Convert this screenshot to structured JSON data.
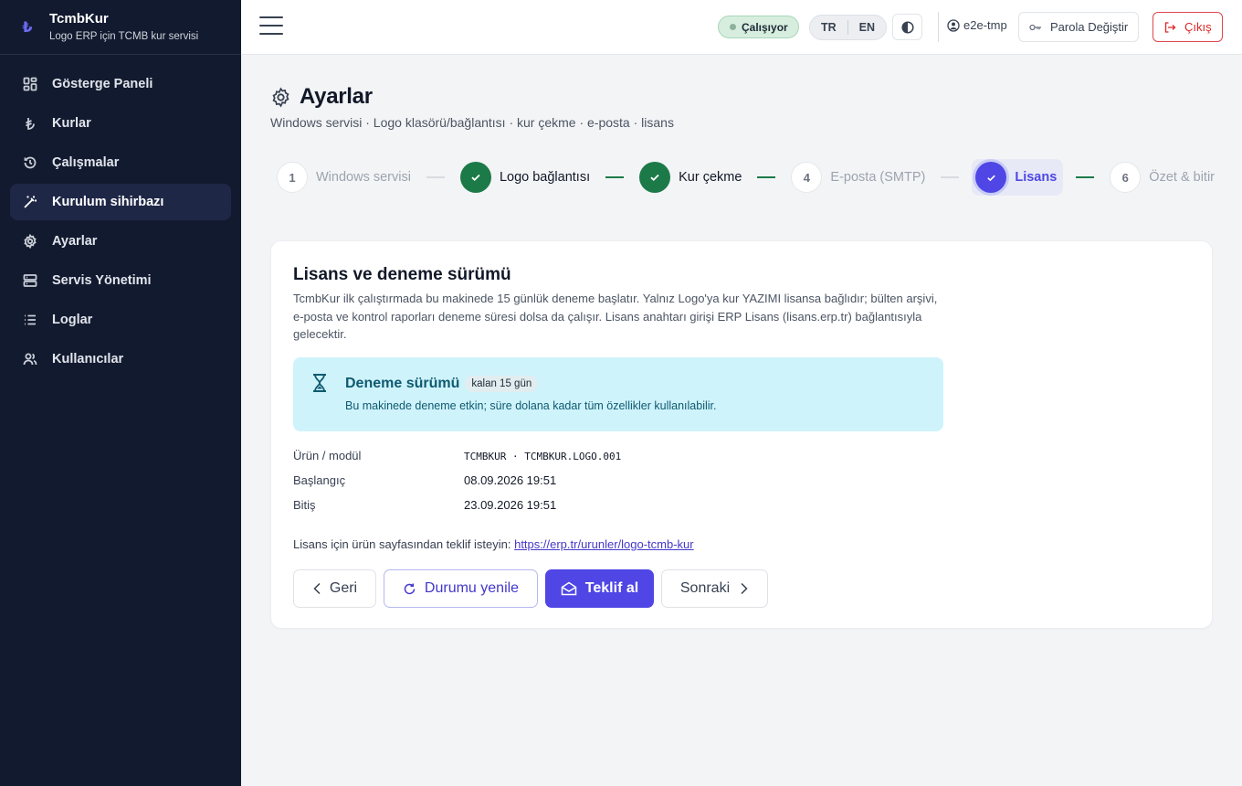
{
  "app": {
    "name": "TcmbKur",
    "subtitle": "Logo ERP için TCMB kur servisi",
    "logo_glyph": "₺"
  },
  "sidebar": {
    "items": [
      {
        "label": "Gösterge Paneli",
        "icon": "dashboard-icon",
        "active": false
      },
      {
        "label": "Kurlar",
        "icon": "lira-icon",
        "active": false
      },
      {
        "label": "Çalışmalar",
        "icon": "history-icon",
        "active": false
      },
      {
        "label": "Kurulum sihirbazı",
        "icon": "wand-icon",
        "active": true
      },
      {
        "label": "Ayarlar",
        "icon": "gear-icon",
        "active": false
      },
      {
        "label": "Servis Yönetimi",
        "icon": "server-icon",
        "active": false
      },
      {
        "label": "Loglar",
        "icon": "list-icon",
        "active": false
      },
      {
        "label": "Kullanıcılar",
        "icon": "users-icon",
        "active": false
      }
    ]
  },
  "topbar": {
    "status": "Çalışıyor",
    "lang_tr": "TR",
    "lang_en": "EN",
    "user": "e2e-tmp",
    "change_password": "Parola Değiştir",
    "logout": "Çıkış"
  },
  "page": {
    "title": "Ayarlar",
    "subtitle": "Windows servisi · Logo klasörü/bağlantısı · kur çekme · e-posta · lisans"
  },
  "steps": [
    {
      "num": "1",
      "label": "Windows servisi",
      "state": "pending"
    },
    {
      "num": "2",
      "label": "Logo bağlantısı",
      "state": "done"
    },
    {
      "num": "3",
      "label": "Kur çekme",
      "state": "done"
    },
    {
      "num": "4",
      "label": "E-posta (SMTP)",
      "state": "pending"
    },
    {
      "num": "5",
      "label": "Lisans",
      "state": "current"
    },
    {
      "num": "6",
      "label": "Özet & bitir",
      "state": "pending"
    }
  ],
  "card": {
    "title": "Lisans ve deneme sürümü",
    "description": "TcmbKur ilk çalıştırmada bu makinede 15 günlük deneme başlatır. Yalnız Logo'ya kur YAZIMI lisansa bağlıdır; bülten arşivi, e-posta ve kontrol raporları deneme süresi dolsa da çalışır. Lisans anahtarı girişi ERP Lisans (lisans.erp.tr) bağlantısıyla gelecektir.",
    "trial": {
      "title": "Deneme sürümü",
      "badge": "kalan 15 gün",
      "text": "Bu makinede deneme etkin; süre dolana kadar tüm özellikler kullanılabilir."
    },
    "info": {
      "product_label": "Ürün / modül",
      "product_value": "TCMBKUR · TCMBKUR.LOGO.001",
      "start_label": "Başlangıç",
      "start_value": "08.09.2026 19:51",
      "end_label": "Bitiş",
      "end_value": "23.09.2026 19:51"
    },
    "license_prompt": "Lisans için ürün sayfasından teklif isteyin:",
    "license_link": "https://erp.tr/urunler/logo-tcmb-kur",
    "buttons": {
      "back": "Geri",
      "refresh": "Durumu yenile",
      "quote": "Teklif al",
      "next": "Sonraki"
    }
  },
  "colors": {
    "sidebar_bg": "#121a2f",
    "accent": "#4f46e5",
    "success": "#1c7a48",
    "danger": "#dc2626",
    "trial_bg": "#cff3fb"
  }
}
